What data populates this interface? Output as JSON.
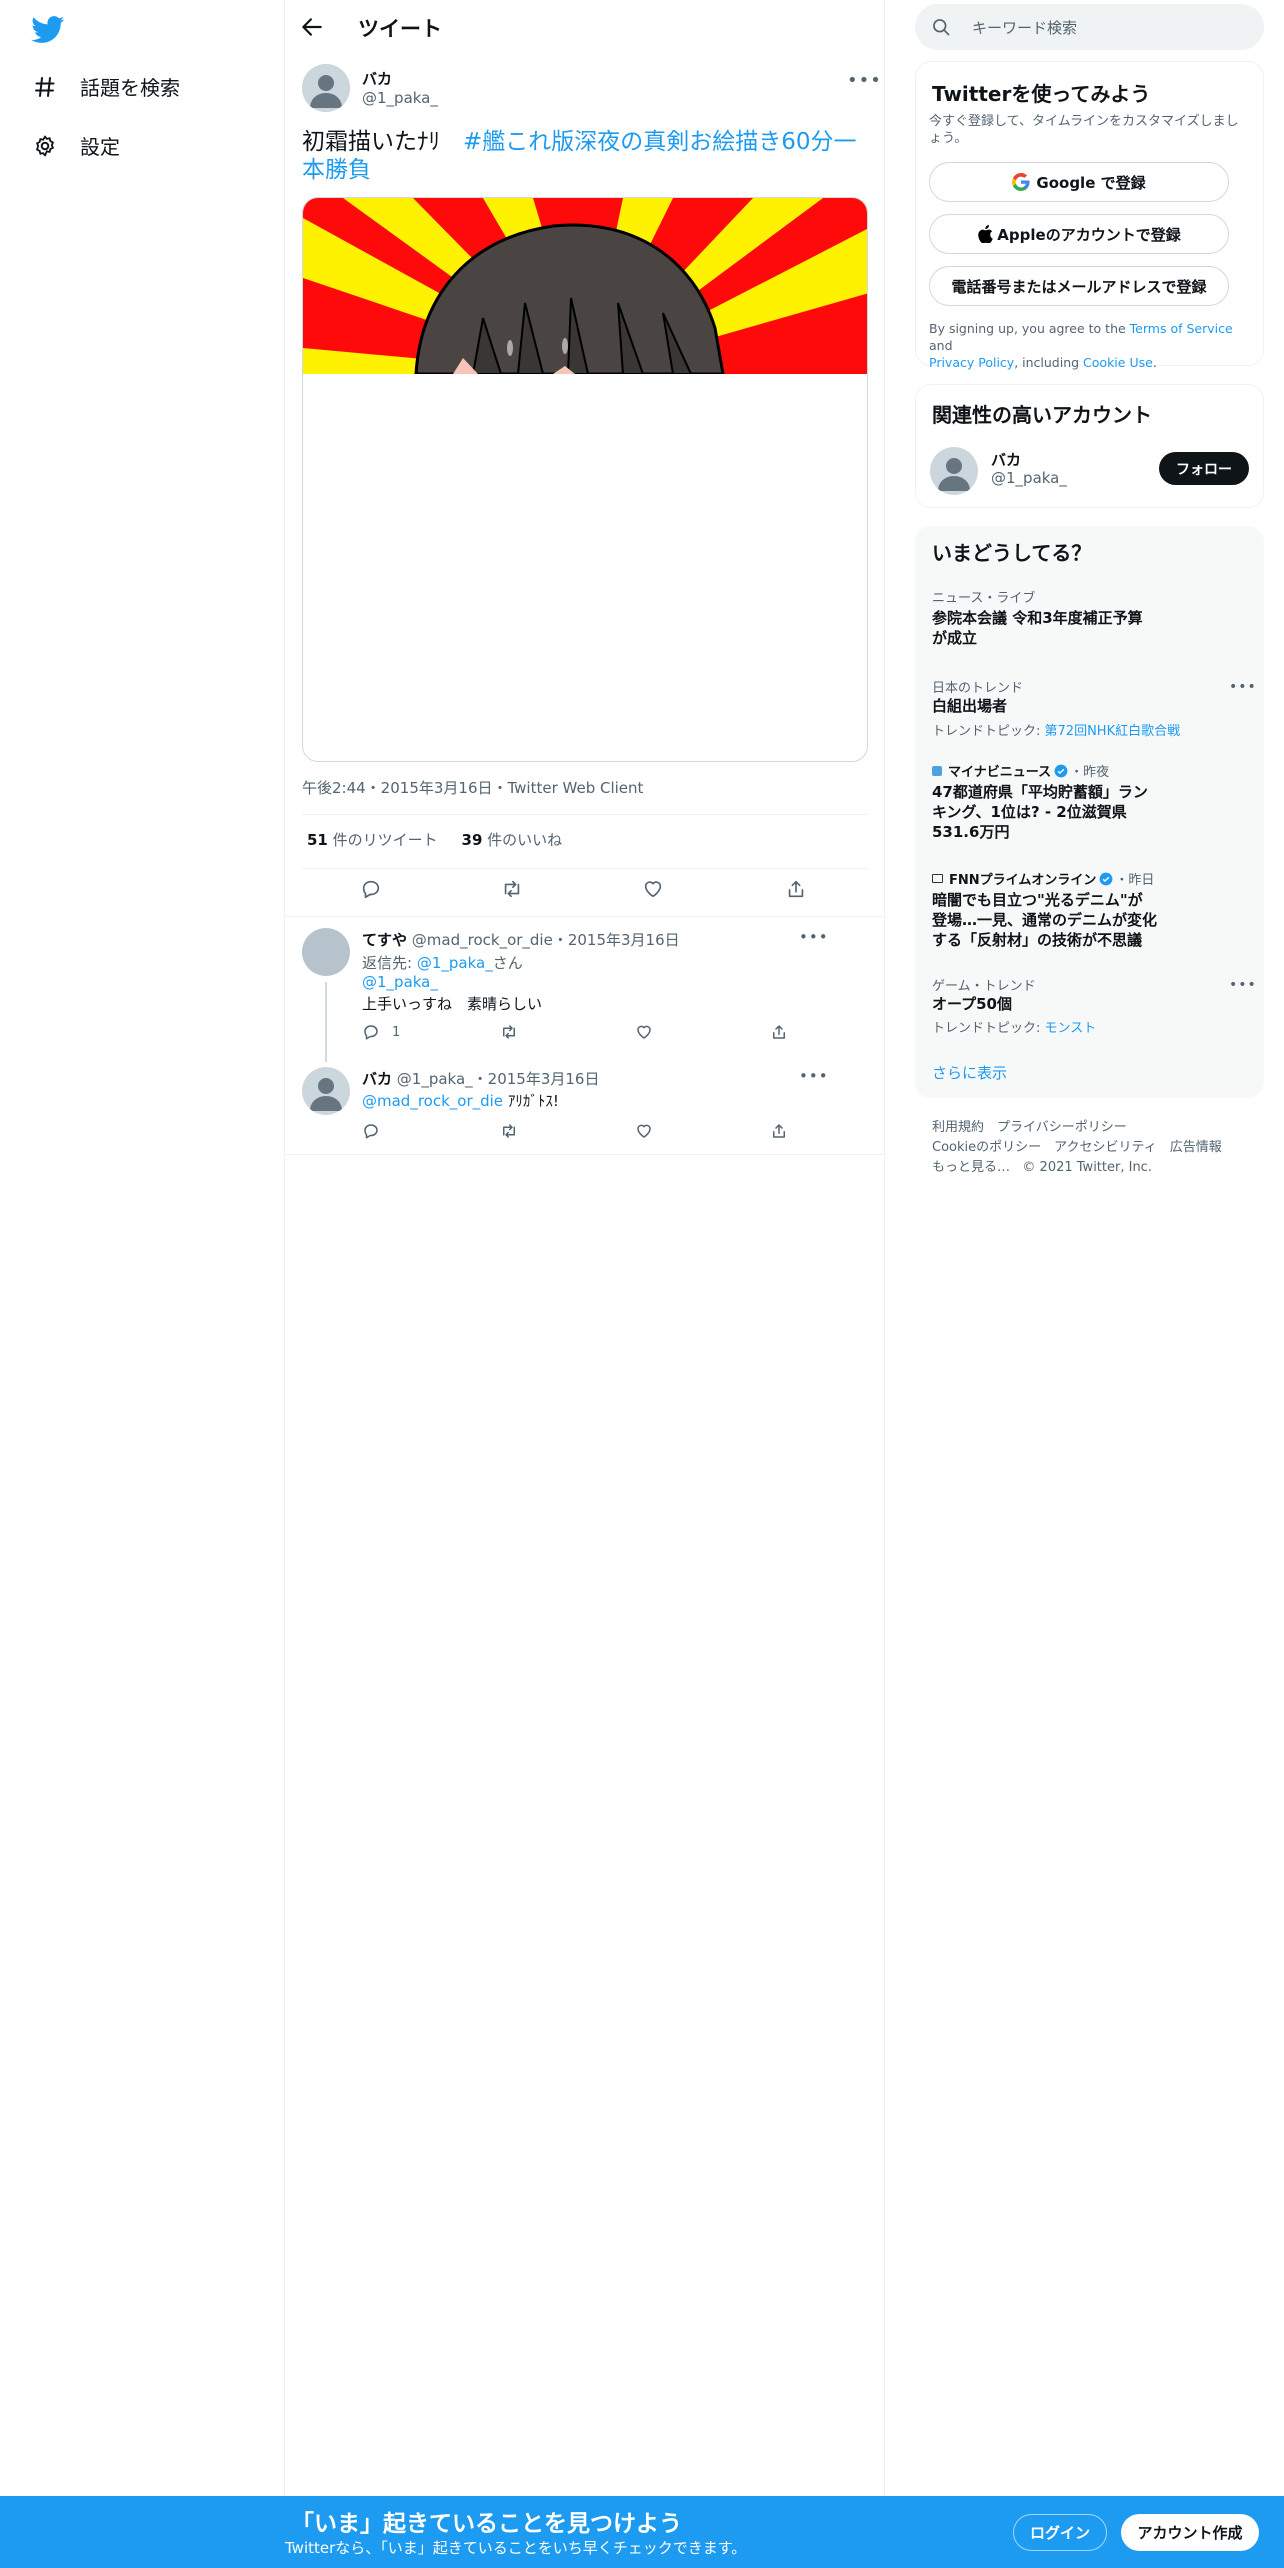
{
  "nav": {
    "items": [
      {
        "label": "話題を検索",
        "icon": "hashtag-icon"
      },
      {
        "label": "設定",
        "icon": "gear-icon"
      }
    ]
  },
  "header": {
    "title": "ツイート"
  },
  "tweet": {
    "name": "バカ",
    "handle": "@1_paka_",
    "text_plain": "初霜描いたﾅﾘ　",
    "hashtag": "#艦これ版深夜の真剣お絵描き60分一本勝負",
    "timestamp": "午後2:44・2015年3月16日・Twitter Web Client",
    "retweets_count": "51",
    "retweets_label": "件のリツイート",
    "likes_count": "39",
    "likes_label": "件のいいね"
  },
  "replies": [
    {
      "name": "てすや",
      "handle": "@mad_rock_or_die",
      "date": "・2015年3月16日",
      "reply_to_label": "返信先:",
      "reply_to_handle": "@1_paka_",
      "reply_to_suffix": "さん",
      "mention": "@1_paka_",
      "text": "上手いっすね　素晴らしい",
      "reply_count": "1"
    },
    {
      "name": "バカ",
      "handle": "@1_paka_",
      "date": "・2015年3月16日",
      "mention": "@mad_rock_or_die",
      "text": "ｱﾘｶﾞﾄｽ!"
    }
  ],
  "search": {
    "placeholder": "キーワード検索"
  },
  "signup_card": {
    "title": "Twitterを使ってみよう",
    "subtitle": "今すぐ登録して、タイムラインをカスタマイズしましょう。",
    "google": "Google で登録",
    "apple": "Appleのアカウントで登録",
    "phone": "電話番号またはメールアドレスで登録",
    "legal_1": "By signing up, you agree to the ",
    "terms": "Terms of Service",
    "legal_and": " and",
    "privacy": "Privacy Policy",
    "legal_2": ", including ",
    "cookie": "Cookie Use",
    "legal_end": "."
  },
  "related": {
    "title": "関連性の高いアカウント",
    "name": "バカ",
    "handle": "@1_paka_",
    "follow": "フォロー"
  },
  "trends": {
    "title": "いまどうしてる？",
    "items": [
      {
        "category": "ニュース・ライブ",
        "title": "参院本会議 令和3年度補正予算が成立"
      },
      {
        "category": "日本のトレンド",
        "title": "白組出場者",
        "sub_label": "トレンドトピック:",
        "sub_link": "第72回NHK紅白歌合戦"
      },
      {
        "source": "マイナビニュース",
        "time": "・昨夜",
        "title": "47都道府県「平均貯蓄額」ランキング、1位は? - 2位滋賀県531.6万円"
      },
      {
        "source": "FNNプライムオンライン",
        "time": "・昨日",
        "title": "暗闇でも目立つ\"光るデニム\"が登場…一見、通常のデニムが変化する「反射材」の技術が不思議"
      },
      {
        "category": "ゲーム・トレンド",
        "title": "オープ50個",
        "sub_label": "トレンドトピック:",
        "sub_link": "モンスト"
      }
    ],
    "show_more": "さらに表示"
  },
  "footer": {
    "row1": "利用規約　プライバシーポリシー",
    "row2": "Cookieのポリシー　アクセシビリティ　広告情報",
    "more": "もっと見る…",
    "copyright": "© 2021 Twitter, Inc."
  },
  "banner": {
    "title": "「いま」起きていることを見つけよう",
    "subtitle": "Twitterなら、「いま」起きていることをいち早くチェックできます。",
    "login": "ログイン",
    "signup": "アカウント作成"
  },
  "colors": {
    "brand": "#1d9bf0",
    "text": "#0f1419",
    "secondary": "#536471",
    "verified": "#1d9bf0"
  }
}
